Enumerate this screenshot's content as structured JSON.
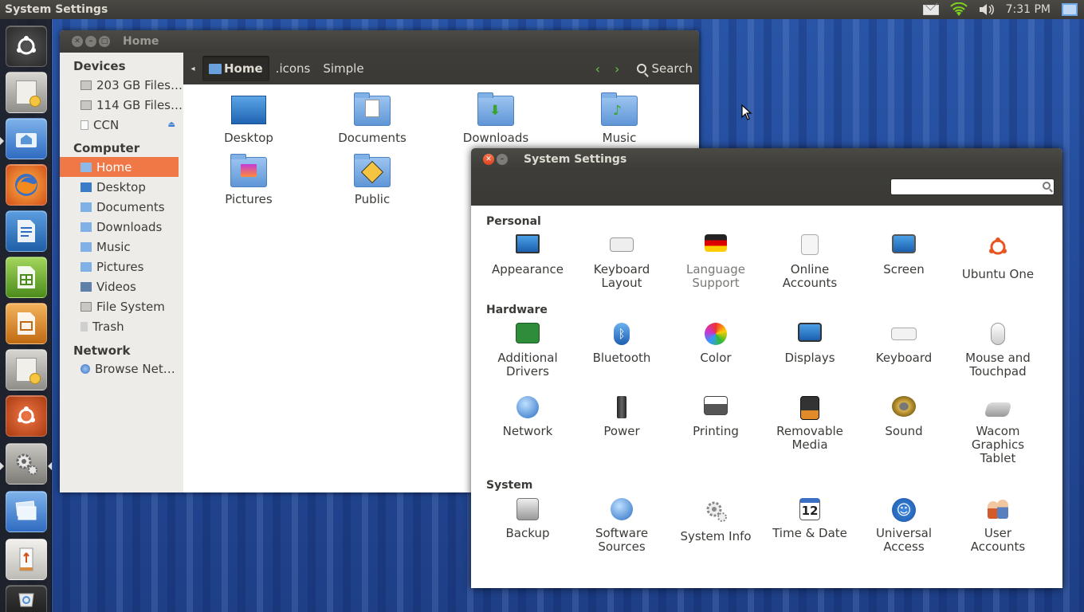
{
  "top_panel": {
    "title": "System Settings",
    "clock": "7:31 PM"
  },
  "files": {
    "title": "Home",
    "breadcrumbs": [
      "Home",
      ".icons",
      "Simple"
    ],
    "search_label": "Search",
    "sidebar": {
      "devices_header": "Devices",
      "devices": [
        "203 GB Files…",
        "114 GB Files…",
        "CCN"
      ],
      "computer_header": "Computer",
      "computer": [
        "Home",
        "Desktop",
        "Documents",
        "Downloads",
        "Music",
        "Pictures",
        "Videos",
        "File System",
        "Trash"
      ],
      "network_header": "Network",
      "network": [
        "Browse Net…"
      ]
    },
    "items": [
      "Desktop",
      "Documents",
      "Downloads",
      "Music",
      "Pictures",
      "Public"
    ]
  },
  "settings": {
    "title": "System Settings",
    "search_placeholder": "",
    "sections": {
      "personal": "Personal",
      "hardware": "Hardware",
      "system": "System"
    },
    "personal": [
      {
        "l1": "Appearance",
        "l2": ""
      },
      {
        "l1": "Keyboard",
        "l2": "Layout"
      },
      {
        "l1": "Language",
        "l2": "Support"
      },
      {
        "l1": "Online",
        "l2": "Accounts"
      },
      {
        "l1": "Screen",
        "l2": ""
      },
      {
        "l1": "Ubuntu One",
        "l2": ""
      }
    ],
    "hardware_row1": [
      {
        "l1": "Additional",
        "l2": "Drivers"
      },
      {
        "l1": "Bluetooth",
        "l2": ""
      },
      {
        "l1": "Color",
        "l2": ""
      },
      {
        "l1": "Displays",
        "l2": ""
      },
      {
        "l1": "Keyboard",
        "l2": ""
      },
      {
        "l1": "Mouse and",
        "l2": "Touchpad"
      }
    ],
    "hardware_row2": [
      {
        "l1": "Network",
        "l2": "",
        "l3": ""
      },
      {
        "l1": "Power",
        "l2": "",
        "l3": ""
      },
      {
        "l1": "Printing",
        "l2": "",
        "l3": ""
      },
      {
        "l1": "Removable",
        "l2": "Media",
        "l3": ""
      },
      {
        "l1": "Sound",
        "l2": "",
        "l3": ""
      },
      {
        "l1": "Wacom",
        "l2": "Graphics",
        "l3": "Tablet"
      }
    ],
    "system": [
      {
        "l1": "Backup",
        "l2": ""
      },
      {
        "l1": "Software",
        "l2": "Sources"
      },
      {
        "l1": "System Info",
        "l2": ""
      },
      {
        "l1": "Time & Date",
        "l2": ""
      },
      {
        "l1": "Universal",
        "l2": "Access"
      },
      {
        "l1": "User",
        "l2": "Accounts"
      }
    ],
    "calendar_day": "12"
  }
}
